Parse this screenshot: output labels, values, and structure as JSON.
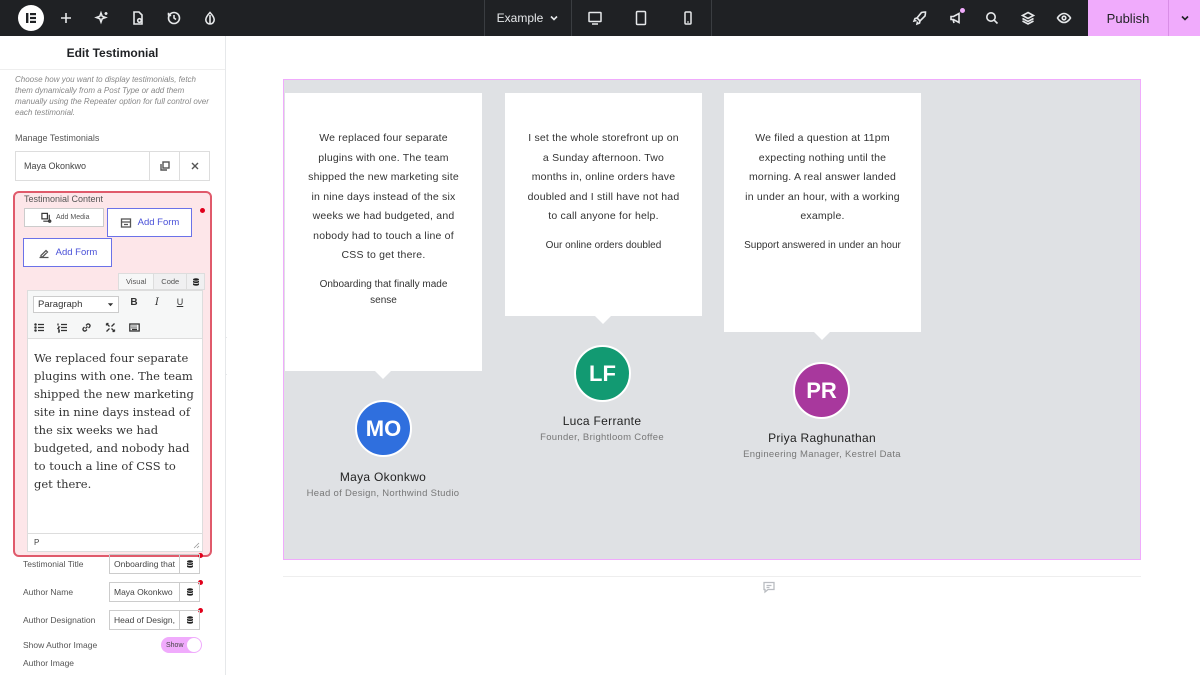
{
  "topbar": {
    "document_name": "Example",
    "publish_label": "Publish"
  },
  "panel": {
    "title": "Edit Testimonial",
    "description": "Choose how you want to display testimonials, fetch them dynamically from a Post Type or add them manually using the Repeater option for full control over each testimonial.",
    "manage_label": "Manage Testimonials",
    "repeater_item": "Maya Okonkwo",
    "content_label": "Testimonial Content",
    "add_media_label": "Add Media",
    "add_form_label_1": "Add Form",
    "add_form_label_2": "Add Form",
    "tab_visual": "Visual",
    "tab_code": "Code",
    "paragraph_select": "Paragraph",
    "bold": "B",
    "italic": "I",
    "underline": "U",
    "editor_text": "We replaced four separate plugins with one. The team shipped the new marketing site in nine days instead of the six weeks we had budgeted, and nobody had to touch a line of CSS to get there.",
    "editor_path": "P",
    "fields": {
      "title_label": "Testimonial Title",
      "title_value": "Onboarding that",
      "name_label": "Author Name",
      "name_value": "Maya Okonkwo",
      "designation_label": "Author Designation",
      "designation_value": "Head of Design,",
      "show_image_label": "Show Author Image",
      "show_image_toggle": "Show",
      "author_image_label": "Author Image"
    }
  },
  "testimonials": [
    {
      "text": "We replaced four separate plugins with one. The team shipped the new marketing site in nine days instead of the six weeks we had budgeted, and nobody had to touch a line of CSS to get there.",
      "title": "Onboarding that finally made sense",
      "initials": "MO",
      "name": "Maya Okonkwo",
      "designation": "Head of Design, Northwind Studio",
      "color": "#2f6fde"
    },
    {
      "text": "I set the whole storefront up on a Sunday afternoon. Two months in, online orders have doubled and I still have not had to call anyone for help.",
      "title": "Our online orders doubled",
      "initials": "LF",
      "name": "Luca Ferrante",
      "designation": "Founder, Brightloom Coffee",
      "color": "#129a72"
    },
    {
      "text": "We filed a question at 11pm expecting nothing until the morning. A real answer landed in under an hour, with a working example.",
      "title": "Support answered in under an hour",
      "initials": "PR",
      "name": "Priya Raghunathan",
      "designation": "Engineering Manager, Kestrel Data",
      "color": "#a8389d"
    }
  ],
  "colors": {
    "accent": "#f0abfc",
    "highlight_border": "#e05a6b",
    "link_blue": "#4a51d8"
  }
}
